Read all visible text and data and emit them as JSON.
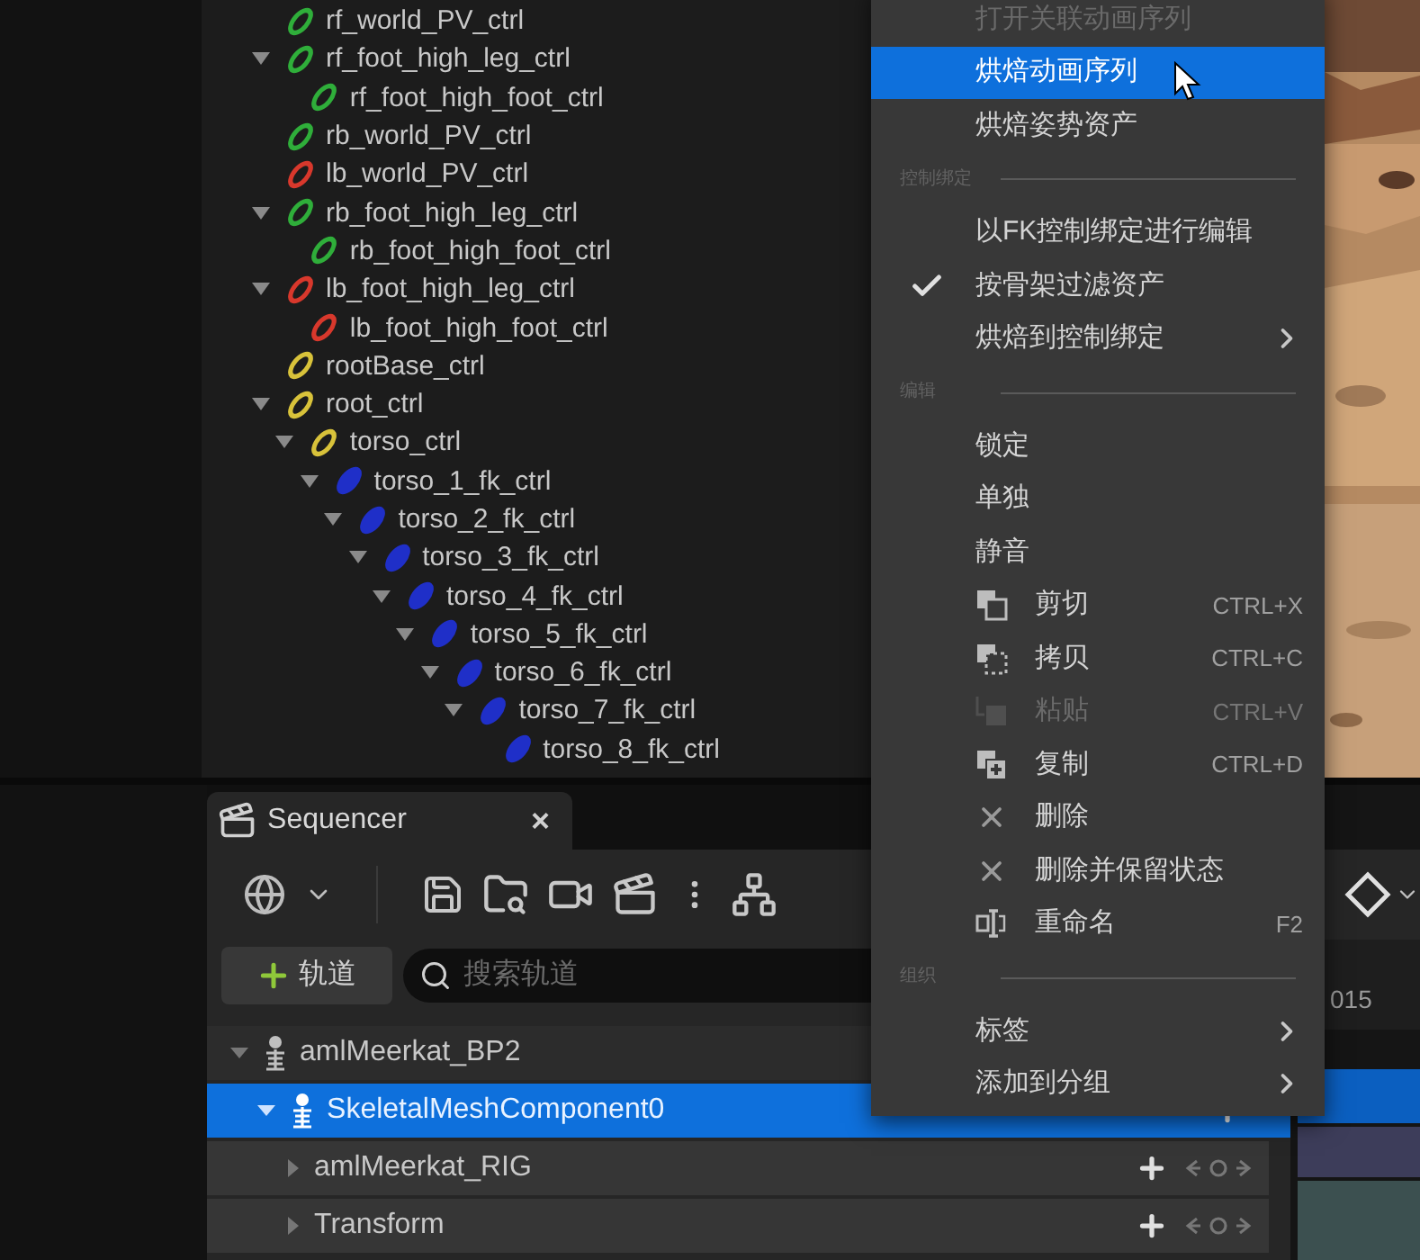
{
  "outliner": {
    "nodes": [
      {
        "label": "rf_world_PV_ctrl",
        "color": "#2fae3a",
        "kind": "ring",
        "expanded": false
      },
      {
        "label": "rf_foot_high_leg_ctrl",
        "color": "#2fae3a",
        "kind": "ring",
        "expanded": true,
        "children": [
          {
            "label": "rf_foot_high_foot_ctrl",
            "color": "#2fae3a",
            "kind": "ring",
            "expanded": false
          }
        ]
      },
      {
        "label": "rb_world_PV_ctrl",
        "color": "#2fae3a",
        "kind": "ring",
        "expanded": false
      },
      {
        "label": "lb_world_PV_ctrl",
        "color": "#d8382c",
        "kind": "ring",
        "expanded": false
      },
      {
        "label": "rb_foot_high_leg_ctrl",
        "color": "#2fae3a",
        "kind": "ring",
        "expanded": true,
        "children": [
          {
            "label": "rb_foot_high_foot_ctrl",
            "color": "#2fae3a",
            "kind": "ring",
            "expanded": false
          }
        ]
      },
      {
        "label": "lb_foot_high_leg_ctrl",
        "color": "#d8382c",
        "kind": "ring",
        "expanded": true,
        "children": [
          {
            "label": "lb_foot_high_foot_ctrl",
            "color": "#d8382c",
            "kind": "ring",
            "expanded": false
          }
        ]
      },
      {
        "label": "rootBase_ctrl",
        "color": "#d8c23a",
        "kind": "ring",
        "expanded": false
      },
      {
        "label": "root_ctrl",
        "color": "#d8c23a",
        "kind": "ring",
        "expanded": true,
        "children": [
          {
            "label": "torso_ctrl",
            "color": "#d8c23a",
            "kind": "ring",
            "expanded": true,
            "children": [
              {
                "label": "torso_1_fk_ctrl",
                "color": "#1f2fc8",
                "kind": "disc",
                "expanded": true,
                "children": [
                  {
                    "label": "torso_2_fk_ctrl",
                    "color": "#1f2fc8",
                    "kind": "disc",
                    "expanded": true,
                    "children": [
                      {
                        "label": "torso_3_fk_ctrl",
                        "color": "#1f2fc8",
                        "kind": "disc",
                        "expanded": true,
                        "children": [
                          {
                            "label": "torso_4_fk_ctrl",
                            "color": "#1f2fc8",
                            "kind": "disc",
                            "expanded": true,
                            "children": [
                              {
                                "label": "torso_5_fk_ctrl",
                                "color": "#1f2fc8",
                                "kind": "disc",
                                "expanded": true,
                                "children": [
                                  {
                                    "label": "torso_6_fk_ctrl",
                                    "color": "#1f2fc8",
                                    "kind": "disc",
                                    "expanded": true,
                                    "children": [
                                      {
                                        "label": "torso_7_fk_ctrl",
                                        "color": "#1f2fc8",
                                        "kind": "disc",
                                        "expanded": true,
                                        "children": [
                                          {
                                            "label": "torso_8_fk_ctrl",
                                            "color": "#1f2fc8",
                                            "kind": "disc",
                                            "expanded": false
                                          }
                                        ]
                                      }
                                    ]
                                  }
                                ]
                              }
                            ]
                          }
                        ]
                      }
                    ]
                  }
                ]
              }
            ]
          }
        ]
      }
    ]
  },
  "context_menu": {
    "sections": [
      {
        "items": [
          {
            "label": "打开关联动画序列",
            "kind": "plain",
            "disabled": true,
            "selected": false,
            "checked": false,
            "submenu": false
          },
          {
            "label": "烘焙动画序列",
            "kind": "plain",
            "disabled": false,
            "selected": true,
            "checked": false,
            "submenu": false
          },
          {
            "label": "烘焙姿势资产",
            "kind": "plain",
            "disabled": false,
            "selected": false,
            "checked": false,
            "submenu": false
          }
        ]
      },
      {
        "header": "控制绑定",
        "items": [
          {
            "label": "以FK控制绑定进行编辑",
            "kind": "plain",
            "disabled": false,
            "selected": false,
            "checked": false,
            "submenu": false
          },
          {
            "label": "按骨架过滤资产",
            "kind": "plain",
            "disabled": false,
            "selected": false,
            "checked": true,
            "submenu": false
          },
          {
            "label": "烘焙到控制绑定",
            "kind": "plain",
            "disabled": false,
            "selected": false,
            "checked": false,
            "submenu": true
          }
        ]
      },
      {
        "header": "编辑",
        "items": [
          {
            "label": "锁定",
            "kind": "plain",
            "disabled": false,
            "selected": false,
            "checked": false,
            "submenu": false
          },
          {
            "label": "单独",
            "kind": "plain",
            "disabled": false,
            "selected": false,
            "checked": false,
            "submenu": false
          },
          {
            "label": "静音",
            "kind": "plain",
            "disabled": false,
            "selected": false,
            "checked": false,
            "submenu": false
          },
          {
            "label": "剪切",
            "kind": "cut",
            "shortcut": "CTRL+X",
            "disabled": false,
            "selected": false,
            "checked": false,
            "submenu": false
          },
          {
            "label": "拷贝",
            "kind": "copy",
            "shortcut": "CTRL+C",
            "disabled": false,
            "selected": false,
            "checked": false,
            "submenu": false
          },
          {
            "label": "粘贴",
            "kind": "paste",
            "shortcut": "CTRL+V",
            "disabled": true,
            "selected": false,
            "checked": false,
            "submenu": false
          },
          {
            "label": "复制",
            "kind": "duplicate",
            "shortcut": "CTRL+D",
            "disabled": false,
            "selected": false,
            "checked": false,
            "submenu": false
          },
          {
            "label": "删除",
            "kind": "delete",
            "disabled": false,
            "selected": false,
            "checked": false,
            "submenu": false
          },
          {
            "label": "删除并保留状态",
            "kind": "delete",
            "disabled": false,
            "selected": false,
            "checked": false,
            "submenu": false
          },
          {
            "label": "重命名",
            "kind": "rename",
            "shortcut": "F2",
            "disabled": false,
            "selected": false,
            "checked": false,
            "submenu": false
          }
        ]
      },
      {
        "header": "组织",
        "items": [
          {
            "label": "标签",
            "kind": "plain",
            "disabled": false,
            "selected": false,
            "checked": false,
            "submenu": true
          },
          {
            "label": "添加到分组",
            "kind": "plain",
            "disabled": false,
            "selected": false,
            "checked": false,
            "submenu": true
          }
        ]
      }
    ]
  },
  "sequencer": {
    "tab": {
      "title": "Sequencer",
      "close": "×"
    },
    "add_track_button": "轨道",
    "search": {
      "placeholder": "搜索轨道"
    },
    "tracks": [
      {
        "label": "amlMeerkat_BP2",
        "kind": "actor",
        "expanded": true,
        "selected": false,
        "children": [
          {
            "label": "SkeletalMeshComponent0",
            "kind": "actor",
            "expanded": true,
            "selected": true,
            "children": [
              {
                "label": "amlMeerkat_RIG",
                "kind": "track",
                "expanded": false,
                "selected": false
              },
              {
                "label": "Transform",
                "kind": "track",
                "expanded": false,
                "selected": false
              }
            ]
          }
        ]
      }
    ]
  },
  "timeline": {
    "frame_label": "015"
  }
}
